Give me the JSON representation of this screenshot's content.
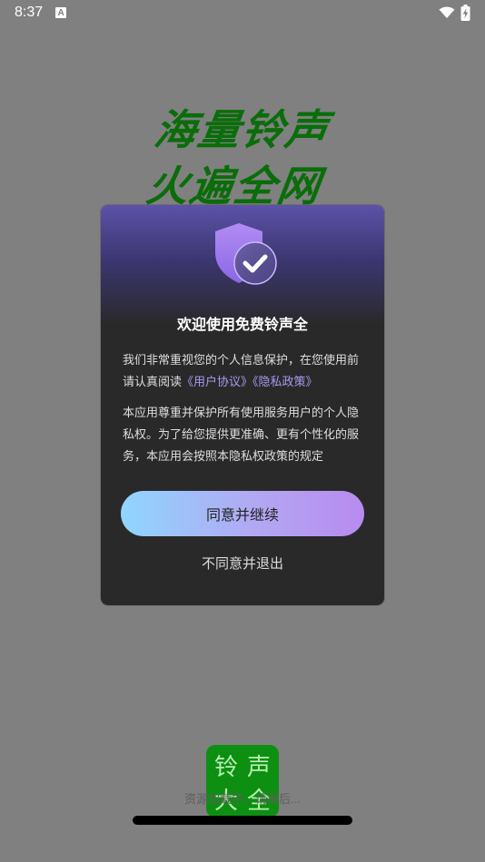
{
  "status_bar": {
    "time": "8:37",
    "notification_icon": "a-icon",
    "wifi_icon": "wifi-icon",
    "battery_icon": "battery-charging-icon"
  },
  "splash": {
    "calligraphy_line1": "海量铃声",
    "calligraphy_line2": "火遍全网",
    "logo_chars": [
      "铃",
      "声",
      "大",
      "全"
    ],
    "loading_text": "资源加载中，请稍后...",
    "brand_color": "#0d8f12"
  },
  "dialog": {
    "title": "欢迎使用免费铃声全",
    "para1_text": "我们非常重视您的个人信息保护，在您使用前请认真阅读",
    "link_user_agreement": "《用户协议》",
    "link_privacy_policy": "《隐私政策》",
    "para2_text": "本应用尊重并保护所有使用服务用户的个人隐私权。为了给您提供更准确、更有个性化的服务，本应用会按照本隐私权政策的规定",
    "agree_label": "同意并继续",
    "disagree_label": "不同意并退出",
    "accent_color": "#a89af0"
  }
}
